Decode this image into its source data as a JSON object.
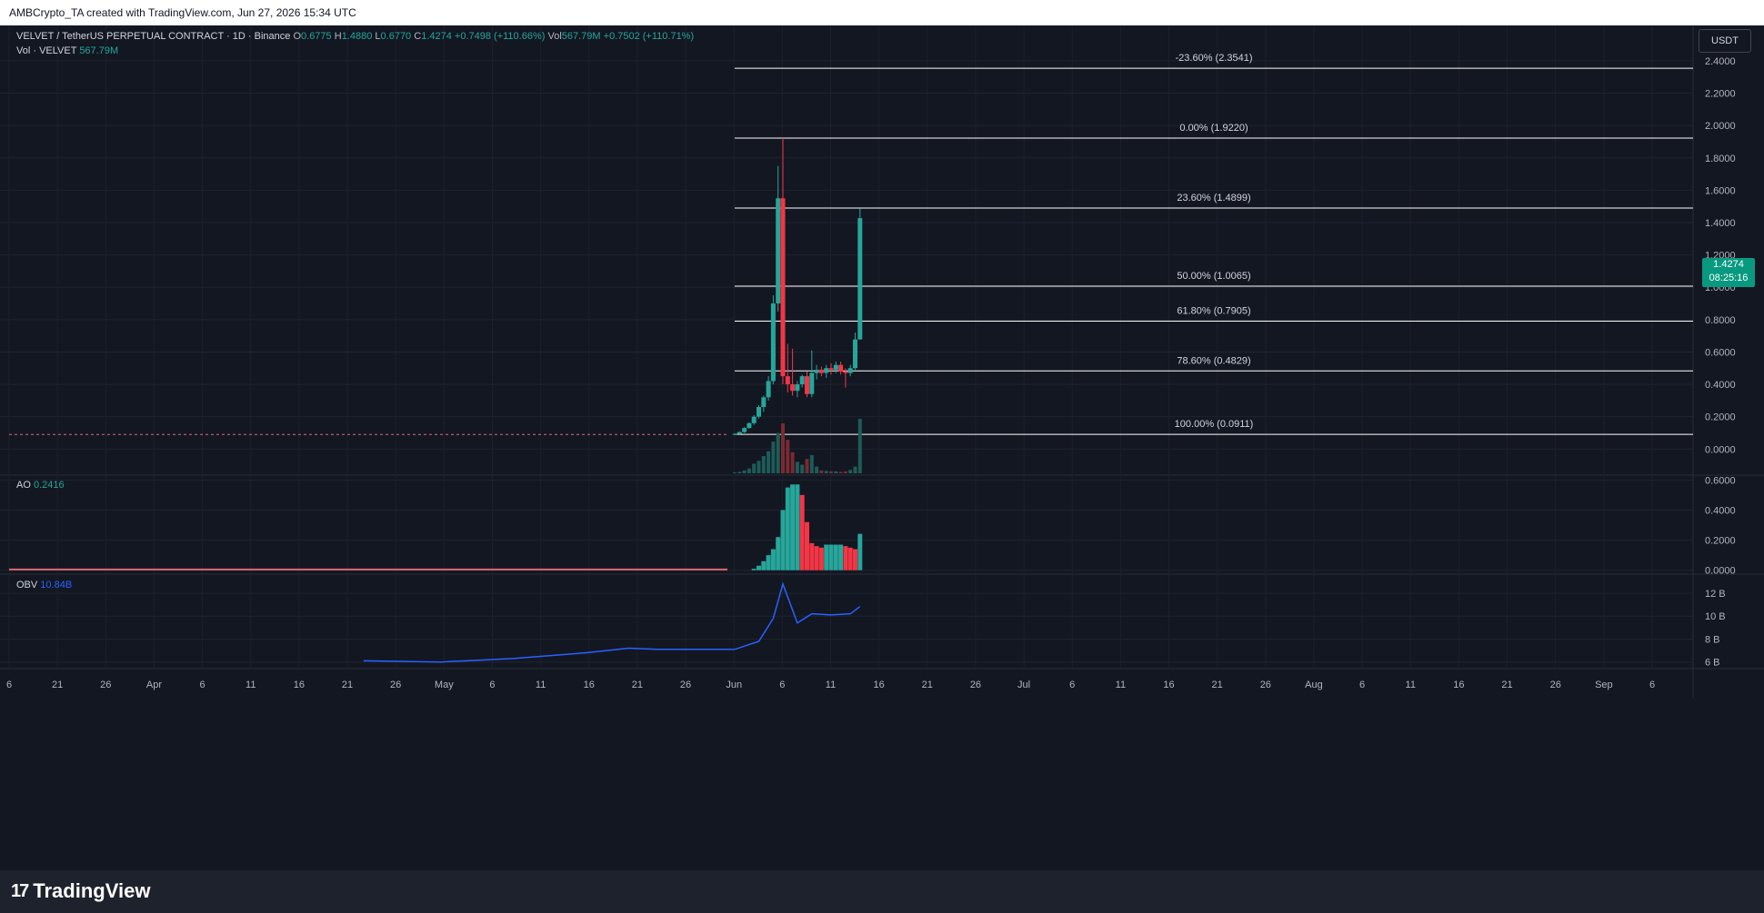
{
  "header": {
    "credit": "AMBCrypto_TA created with TradingView.com, Jun 27, 2026 15:34 UTC"
  },
  "legend": {
    "symbol": "VELVET / TetherUS PERPETUAL CONTRACT · 1D · Binance",
    "o_label": "O",
    "o_value": "0.6775",
    "h_label": "H",
    "h_value": "1.4880",
    "l_label": "L",
    "l_value": "0.6770",
    "c_label": "C",
    "c_value": "1.4274",
    "change": "+0.7498 (+110.66%)",
    "vol_label": "Vol",
    "vol_value": "567.79M",
    "vol_change": "+0.7502 (+110.71%)",
    "vol_row_label": "Vol · VELVET",
    "vol_row_value": "567.79M",
    "ao_label": "AO",
    "ao_value": "0.2416",
    "obv_label": "OBV",
    "obv_value": "10.84B"
  },
  "currency_button": "USDT",
  "price_tag": {
    "price": "1.4274",
    "countdown": "08:25:16"
  },
  "fib_levels": [
    {
      "label": "-23.60% (2.3541)",
      "price": 2.3541
    },
    {
      "label": "0.00% (1.9220)",
      "price": 1.922
    },
    {
      "label": "23.60% (1.4899)",
      "price": 1.4899
    },
    {
      "label": "50.00% (1.0065)",
      "price": 1.0065
    },
    {
      "label": "61.80% (0.7905)",
      "price": 0.7905
    },
    {
      "label": "78.60% (0.4829)",
      "price": 0.4829
    },
    {
      "label": "100.00% (0.0911)",
      "price": 0.0911
    }
  ],
  "price_axis": [
    "2.4000",
    "2.2000",
    "2.0000",
    "1.8000",
    "1.6000",
    "1.4000",
    "1.2000",
    "1.0000",
    "0.8000",
    "0.6000",
    "0.4000",
    "0.2000",
    "0.0000"
  ],
  "ao_axis": [
    "0.6000",
    "0.4000",
    "0.2000",
    "0.0000"
  ],
  "obv_axis": [
    "12 B",
    "10 B",
    "8 B",
    "6 B"
  ],
  "time_axis": [
    "6",
    "21",
    "26",
    "Apr",
    "6",
    "11",
    "16",
    "21",
    "26",
    "May",
    "6",
    "11",
    "16",
    "21",
    "26",
    "Jun",
    "6",
    "11",
    "16",
    "21",
    "26",
    "Jul",
    "6",
    "11",
    "16",
    "21",
    "26",
    "Aug",
    "6",
    "11",
    "16",
    "21",
    "26",
    "Sep",
    "6"
  ],
  "brand": {
    "name": "TradingView"
  },
  "colors": {
    "up": "#26a69a",
    "down": "#f23645",
    "obv": "#2962ff",
    "fib": "#ffffff"
  },
  "chart_data": {
    "type": "candlestick",
    "candles": [
      {
        "date": "Jun 1",
        "o": 0.09,
        "h": 0.098,
        "l": 0.085,
        "c": 0.094,
        "v": 10
      },
      {
        "date": "Jun 2",
        "o": 0.094,
        "h": 0.11,
        "l": 0.09,
        "c": 0.105,
        "v": 15
      },
      {
        "date": "Jun 3",
        "o": 0.105,
        "h": 0.135,
        "l": 0.1,
        "c": 0.13,
        "v": 30
      },
      {
        "date": "Jun 4",
        "o": 0.13,
        "h": 0.165,
        "l": 0.125,
        "c": 0.16,
        "v": 50
      },
      {
        "date": "Jun 5",
        "o": 0.16,
        "h": 0.21,
        "l": 0.15,
        "c": 0.2,
        "v": 100
      },
      {
        "date": "Jun 6",
        "o": 0.2,
        "h": 0.27,
        "l": 0.19,
        "c": 0.26,
        "v": 130
      },
      {
        "date": "Jun 7",
        "o": 0.26,
        "h": 0.33,
        "l": 0.23,
        "c": 0.32,
        "v": 180
      },
      {
        "date": "Jun 8",
        "o": 0.32,
        "h": 0.45,
        "l": 0.3,
        "c": 0.42,
        "v": 230
      },
      {
        "date": "Jun 9",
        "o": 0.42,
        "h": 0.95,
        "l": 0.4,
        "c": 0.9,
        "v": 330
      },
      {
        "date": "Jun 10",
        "o": 0.9,
        "h": 1.75,
        "l": 0.85,
        "c": 1.55,
        "v": 420
      },
      {
        "date": "Jun 11",
        "o": 1.55,
        "h": 1.922,
        "l": 0.4,
        "c": 0.45,
        "v": 520
      },
      {
        "date": "Jun 12",
        "o": 0.45,
        "h": 0.65,
        "l": 0.35,
        "c": 0.4,
        "v": 350
      },
      {
        "date": "Jun 13",
        "o": 0.4,
        "h": 0.62,
        "l": 0.33,
        "c": 0.36,
        "v": 220
      },
      {
        "date": "Jun 14",
        "o": 0.36,
        "h": 0.42,
        "l": 0.32,
        "c": 0.4,
        "v": 120
      },
      {
        "date": "Jun 15",
        "o": 0.4,
        "h": 0.46,
        "l": 0.38,
        "c": 0.45,
        "v": 90
      },
      {
        "date": "Jun 16",
        "o": 0.45,
        "h": 0.48,
        "l": 0.32,
        "c": 0.34,
        "v": 150
      },
      {
        "date": "Jun 17",
        "o": 0.34,
        "h": 0.61,
        "l": 0.32,
        "c": 0.47,
        "v": 190
      },
      {
        "date": "Jun 18",
        "o": 0.47,
        "h": 0.52,
        "l": 0.43,
        "c": 0.49,
        "v": 70
      },
      {
        "date": "Jun 19",
        "o": 0.49,
        "h": 0.51,
        "l": 0.45,
        "c": 0.47,
        "v": 30
      },
      {
        "date": "Jun 20",
        "o": 0.47,
        "h": 0.52,
        "l": 0.44,
        "c": 0.5,
        "v": 25
      },
      {
        "date": "Jun 21",
        "o": 0.5,
        "h": 0.53,
        "l": 0.46,
        "c": 0.49,
        "v": 20
      },
      {
        "date": "Jun 22",
        "o": 0.49,
        "h": 0.54,
        "l": 0.47,
        "c": 0.52,
        "v": 20
      },
      {
        "date": "Jun 23",
        "o": 0.52,
        "h": 0.54,
        "l": 0.46,
        "c": 0.48,
        "v": 15
      },
      {
        "date": "Jun 24",
        "o": 0.48,
        "h": 0.5,
        "l": 0.38,
        "c": 0.47,
        "v": 20
      },
      {
        "date": "Jun 25",
        "o": 0.47,
        "h": 0.52,
        "l": 0.45,
        "c": 0.5,
        "v": 35
      },
      {
        "date": "Jun 26",
        "o": 0.5,
        "h": 0.72,
        "l": 0.49,
        "c": 0.6775,
        "v": 70
      },
      {
        "date": "Jun 27",
        "o": 0.6775,
        "h": 1.488,
        "l": 0.677,
        "c": 1.4274,
        "v": 567.79
      }
    ],
    "ao": [
      {
        "date": "Jun 5",
        "value": 0.01
      },
      {
        "date": "Jun 6",
        "value": 0.03
      },
      {
        "date": "Jun 7",
        "value": 0.06
      },
      {
        "date": "Jun 8",
        "value": 0.1
      },
      {
        "date": "Jun 9",
        "value": 0.14
      },
      {
        "date": "Jun 10",
        "value": 0.22
      },
      {
        "date": "Jun 11",
        "value": 0.4
      },
      {
        "date": "Jun 12",
        "value": 0.55
      },
      {
        "date": "Jun 13",
        "value": 0.57
      },
      {
        "date": "Jun 14",
        "value": 0.57
      },
      {
        "date": "Jun 15",
        "value": 0.5
      },
      {
        "date": "Jun 16",
        "value": 0.32
      },
      {
        "date": "Jun 17",
        "value": 0.18
      },
      {
        "date": "Jun 18",
        "value": 0.16
      },
      {
        "date": "Jun 19",
        "value": 0.15
      },
      {
        "date": "Jun 20",
        "value": 0.17
      },
      {
        "date": "Jun 21",
        "value": 0.17
      },
      {
        "date": "Jun 22",
        "value": 0.17
      },
      {
        "date": "Jun 23",
        "value": 0.17
      },
      {
        "date": "Jun 24",
        "value": 0.16
      },
      {
        "date": "Jun 25",
        "value": 0.15
      },
      {
        "date": "Jun 26",
        "value": 0.14
      },
      {
        "date": "Jun 27",
        "value": 0.2416
      }
    ],
    "obv": [
      {
        "date": "Mar 16",
        "value": 6.1
      },
      {
        "date": "Apr 1",
        "value": 6.0
      },
      {
        "date": "Apr 16",
        "value": 6.3
      },
      {
        "date": "May 1",
        "value": 6.8
      },
      {
        "date": "May 10",
        "value": 7.2
      },
      {
        "date": "May 16",
        "value": 7.1
      },
      {
        "date": "Jun 1",
        "value": 7.1
      },
      {
        "date": "Jun 6",
        "value": 7.8
      },
      {
        "date": "Jun 9",
        "value": 9.8
      },
      {
        "date": "Jun 11",
        "value": 12.8
      },
      {
        "date": "Jun 14",
        "value": 9.4
      },
      {
        "date": "Jun 17",
        "value": 10.2
      },
      {
        "date": "Jun 21",
        "value": 10.1
      },
      {
        "date": "Jun 25",
        "value": 10.2
      },
      {
        "date": "Jun 27",
        "value": 10.84
      }
    ],
    "ylim": [
      -0.15,
      2.45
    ],
    "ao_ylim": [
      -0.02,
      0.62
    ],
    "obv_ylim": [
      5.5,
      13.5
    ]
  }
}
